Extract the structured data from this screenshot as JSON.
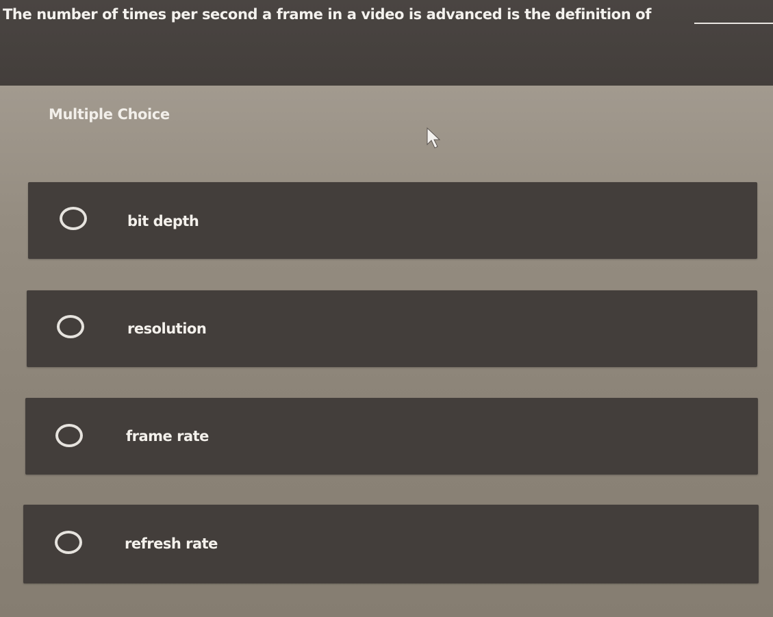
{
  "question": {
    "text": "The number of times per second a frame in a video is advanced is the definition of"
  },
  "question_type": "Multiple Choice",
  "choices": [
    {
      "label": "bit depth"
    },
    {
      "label": "resolution"
    },
    {
      "label": "frame rate"
    },
    {
      "label": "refresh rate"
    }
  ]
}
